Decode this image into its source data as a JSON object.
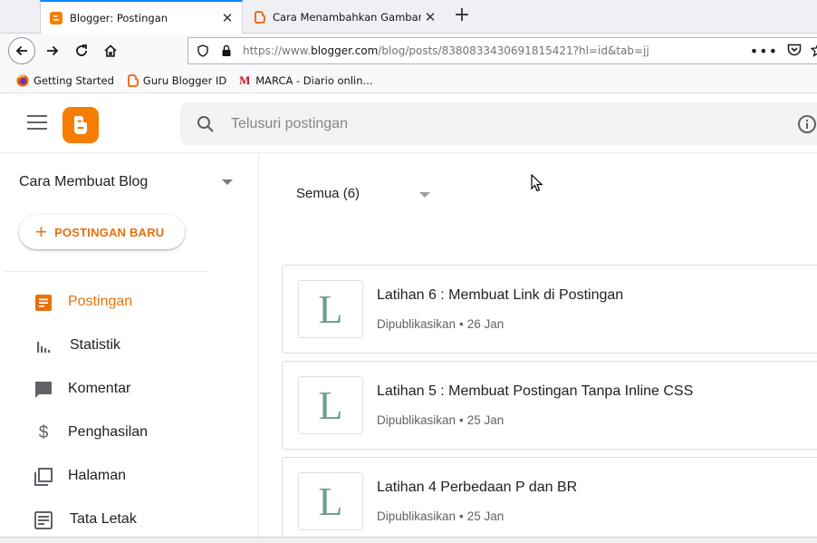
{
  "browser": {
    "tabs": [
      {
        "title": "Blogger: Postingan",
        "active": true
      },
      {
        "title": "Cara Menambahkan Gambar di",
        "active": false
      }
    ],
    "url_prefix": "https://www.",
    "url_domain": "blogger.com",
    "url_path": "/blog/posts/8380833430691815421?hl=id&tab=jj",
    "bookmarks": [
      "Getting Started",
      "Guru Blogger ID",
      "MARCA - Diario onlin..."
    ]
  },
  "search": {
    "placeholder": "Telusuri postingan"
  },
  "sidebar": {
    "blog_name": "Cara Membuat Blog",
    "new_post_label": "POSTINGAN BARU",
    "items": [
      {
        "label": "Postingan",
        "icon": "posts-icon",
        "active": true
      },
      {
        "label": "Statistik",
        "icon": "stats-icon",
        "active": false
      },
      {
        "label": "Komentar",
        "icon": "comment-icon",
        "active": false
      },
      {
        "label": "Penghasilan",
        "icon": "dollar-icon",
        "active": false
      },
      {
        "label": "Halaman",
        "icon": "pages-icon",
        "active": false
      },
      {
        "label": "Tata Letak",
        "icon": "layout-icon",
        "active": false
      }
    ]
  },
  "main": {
    "filter": "Semua (6)",
    "posts": [
      {
        "thumb": "L",
        "title": "Latihan 6 : Membuat Link di Postingan",
        "status": "Dipublikasikan",
        "date": "26 Jan"
      },
      {
        "thumb": "L",
        "title": "Latihan 5 : Membuat Postingan Tanpa Inline CSS",
        "status": "Dipublikasikan",
        "date": "25 Jan"
      },
      {
        "thumb": "L",
        "title": "Latihan 4 Perbedaan P dan BR",
        "status": "Dipublikasikan",
        "date": "25 Jan"
      }
    ]
  },
  "colors": {
    "accent": "#e8710a",
    "logo": "#f57d00",
    "tab_highlight": "#0a84ff"
  }
}
